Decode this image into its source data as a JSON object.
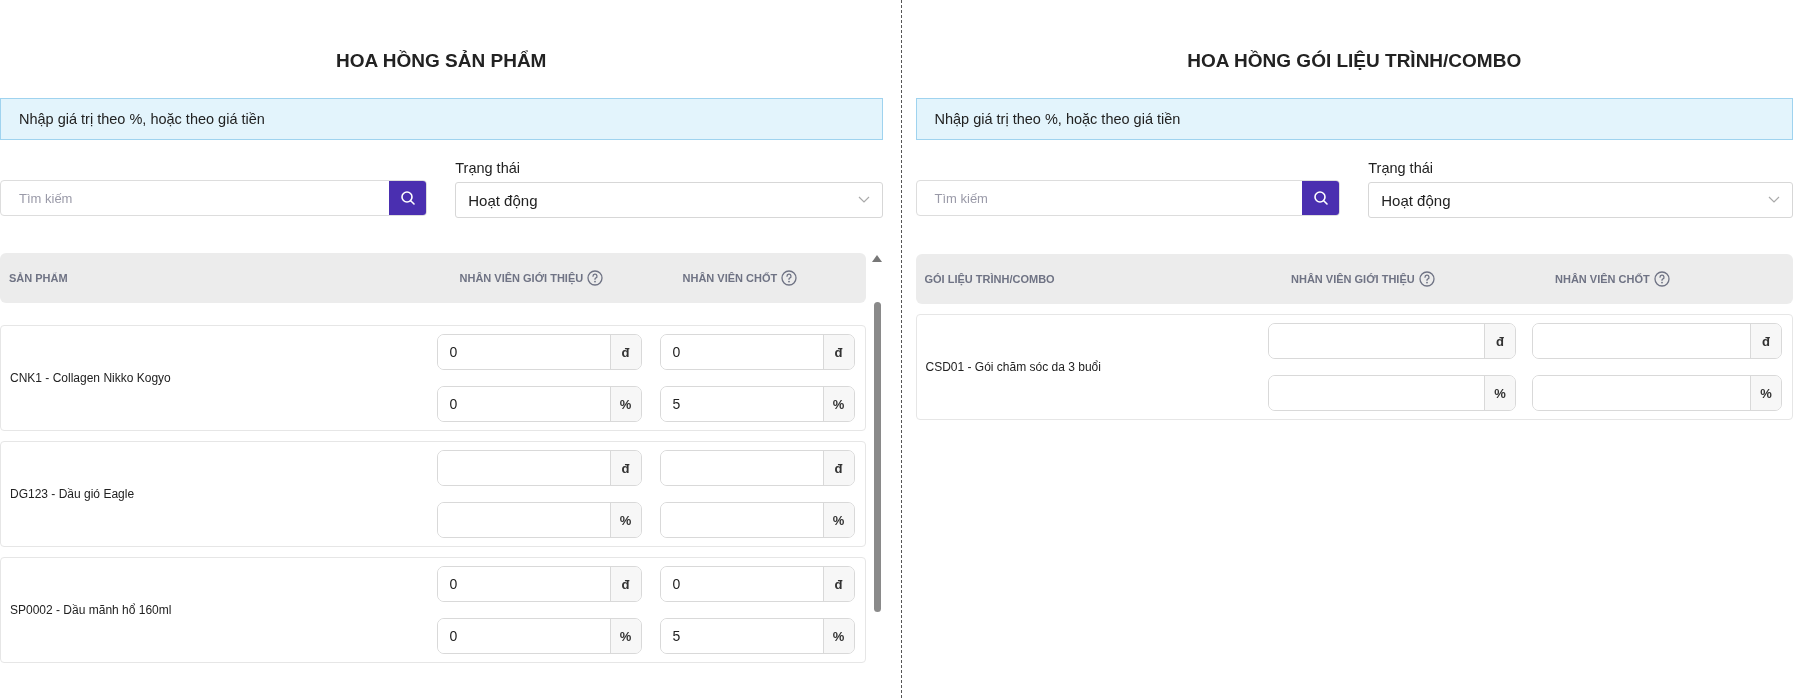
{
  "panels": [
    {
      "title": "HOA HỒNG SẢN PHẨM",
      "notice": "Nhập giá trị theo %, hoặc theo giá tiền",
      "search": {
        "placeholder": "Tìm kiếm"
      },
      "status": {
        "label": "Trạng thái",
        "value": "Hoạt động"
      },
      "scrollable": true,
      "columns": [
        "SẢN PHẨM",
        "NHÂN VIÊN GIỚI THIỆU",
        "NHÂN VIÊN CHỐT"
      ],
      "rows": [
        {
          "name": "CNK1 - Collagen Nikko Kogyo",
          "referrer": [
            {
              "value": "0",
              "unit": "đ"
            },
            {
              "value": "0",
              "unit": "%"
            }
          ],
          "closer": [
            {
              "value": "0",
              "unit": "đ"
            },
            {
              "value": "5",
              "unit": "%"
            }
          ]
        },
        {
          "name": "DG123 - Dầu gió Eagle",
          "referrer": [
            {
              "unit": "đ"
            },
            {
              "unit": "%"
            }
          ],
          "closer": [
            {
              "unit": "đ"
            },
            {
              "unit": "%"
            }
          ]
        },
        {
          "name": "SP0002 - Dầu mãnh hổ 160ml",
          "referrer": [
            {
              "value": "0",
              "unit": "đ"
            },
            {
              "value": "0",
              "unit": "%"
            }
          ],
          "closer": [
            {
              "value": "0",
              "unit": "đ"
            },
            {
              "value": "5",
              "unit": "%"
            }
          ]
        }
      ]
    },
    {
      "title": "HOA HỒNG GÓI LIỆU TRÌNH/COMBO",
      "notice": "Nhập giá trị theo %, hoặc theo giá tiền",
      "search": {
        "placeholder": "Tìm kiếm"
      },
      "status": {
        "label": "Trạng thái",
        "value": "Hoạt động"
      },
      "scrollable": false,
      "columns": [
        "GÓI LIỆU TRÌNH/COMBO",
        "NHÂN VIÊN GIỚI THIỆU",
        "NHÂN VIÊN CHỐT"
      ],
      "rows": [
        {
          "name": "CSD01 - Gói chăm sóc da 3 buổi",
          "referrer": [
            {
              "unit": "đ"
            },
            {
              "unit": "%"
            }
          ],
          "closer": [
            {
              "unit": "đ"
            },
            {
              "unit": "%"
            }
          ]
        }
      ]
    }
  ]
}
